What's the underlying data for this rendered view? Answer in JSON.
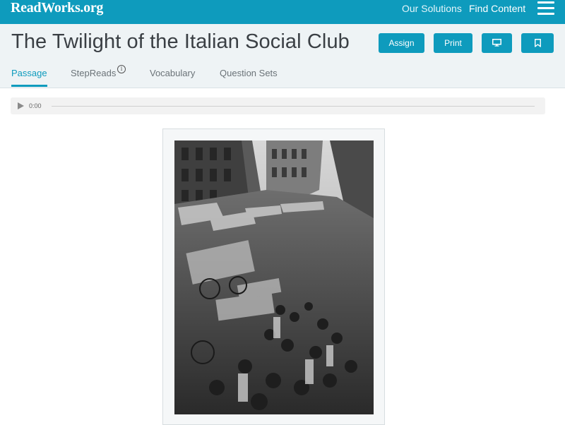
{
  "topbar": {
    "logo": "ReadWorks.org",
    "nav": [
      "Our Solutions",
      "Find Content"
    ],
    "menu_icon": "hamburger-menu-icon"
  },
  "header": {
    "title": "The Twilight of the Italian Social Club",
    "buttons": {
      "assign": "Assign",
      "print": "Print",
      "present_icon": "monitor-icon",
      "bookmark_icon": "bookmark-icon"
    },
    "tabs": [
      {
        "label": "Passage",
        "active": true
      },
      {
        "label": "StepReads",
        "info_icon": "info-icon"
      },
      {
        "label": "Vocabulary"
      },
      {
        "label": "Question Sets"
      }
    ]
  },
  "audio_player": {
    "time": "0:00",
    "play_icon": "play-icon"
  },
  "colors": {
    "brand": "#0e9bbd",
    "header_bg": "#eef3f5",
    "title_text": "#3a3f44"
  }
}
